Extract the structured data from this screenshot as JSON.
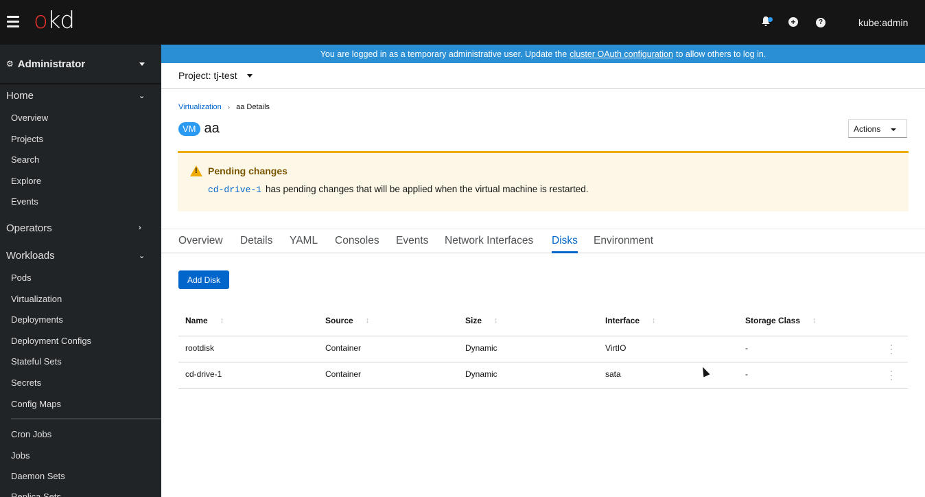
{
  "masthead": {
    "logo_o": "o",
    "logo_rest": "kd",
    "user": "kube:admin",
    "icons": [
      "hamburger-menu-icon",
      "bell-icon",
      "plus-circle-icon",
      "question-circle-icon"
    ]
  },
  "sidebar": {
    "perspective": "Administrator",
    "sections": [
      {
        "label": "Home",
        "expanded": true,
        "items": [
          "Overview",
          "Projects",
          "Search",
          "Explore",
          "Events"
        ]
      },
      {
        "label": "Operators",
        "expanded": false,
        "items": []
      },
      {
        "label": "Workloads",
        "expanded": true,
        "items": [
          "Pods",
          "Virtualization",
          "Deployments",
          "Deployment Configs",
          "Stateful Sets",
          "Secrets",
          "Config Maps",
          "Cron Jobs",
          "Jobs",
          "Daemon Sets",
          "Replica Sets"
        ]
      }
    ]
  },
  "notice": {
    "before": "You are logged in as a temporary administrative user. Update the",
    "link": "cluster OAuth configuration",
    "after": "to allow others to log in."
  },
  "project": {
    "label": "Project: tj-test"
  },
  "breadcrumb": {
    "parent": "Virtualization",
    "current": "aa Details"
  },
  "page": {
    "badge": "VM",
    "title": "aa",
    "actions_label": "Actions"
  },
  "alert": {
    "title": "Pending changes",
    "resource": "cd-drive-1",
    "message": "has pending changes that will be applied when the virtual machine is restarted."
  },
  "tabs": [
    {
      "label": "Overview",
      "active": false
    },
    {
      "label": "Details",
      "active": false
    },
    {
      "label": "YAML",
      "active": false
    },
    {
      "label": "Consoles",
      "active": false
    },
    {
      "label": "Events",
      "active": false
    },
    {
      "label": "Network Interfaces",
      "active": false
    },
    {
      "label": "Disks",
      "active": true
    },
    {
      "label": "Environment",
      "active": false
    }
  ],
  "disks": {
    "add_label": "Add Disk",
    "columns": [
      "Name",
      "Source",
      "Size",
      "Interface",
      "Storage Class"
    ],
    "rows": [
      [
        "rootdisk",
        "Container",
        "Dynamic",
        "VirtIO",
        "-"
      ],
      [
        "cd-drive-1",
        "Container",
        "Dynamic",
        "sata",
        "-"
      ]
    ]
  },
  "colors": {
    "brand_red": "#e8322d",
    "primary_blue": "#0066cc",
    "notice_blue": "#2b8fd6",
    "warning_yellow": "#f0ab00",
    "masthead_bg": "#151515",
    "sidebar_bg": "#212427"
  }
}
